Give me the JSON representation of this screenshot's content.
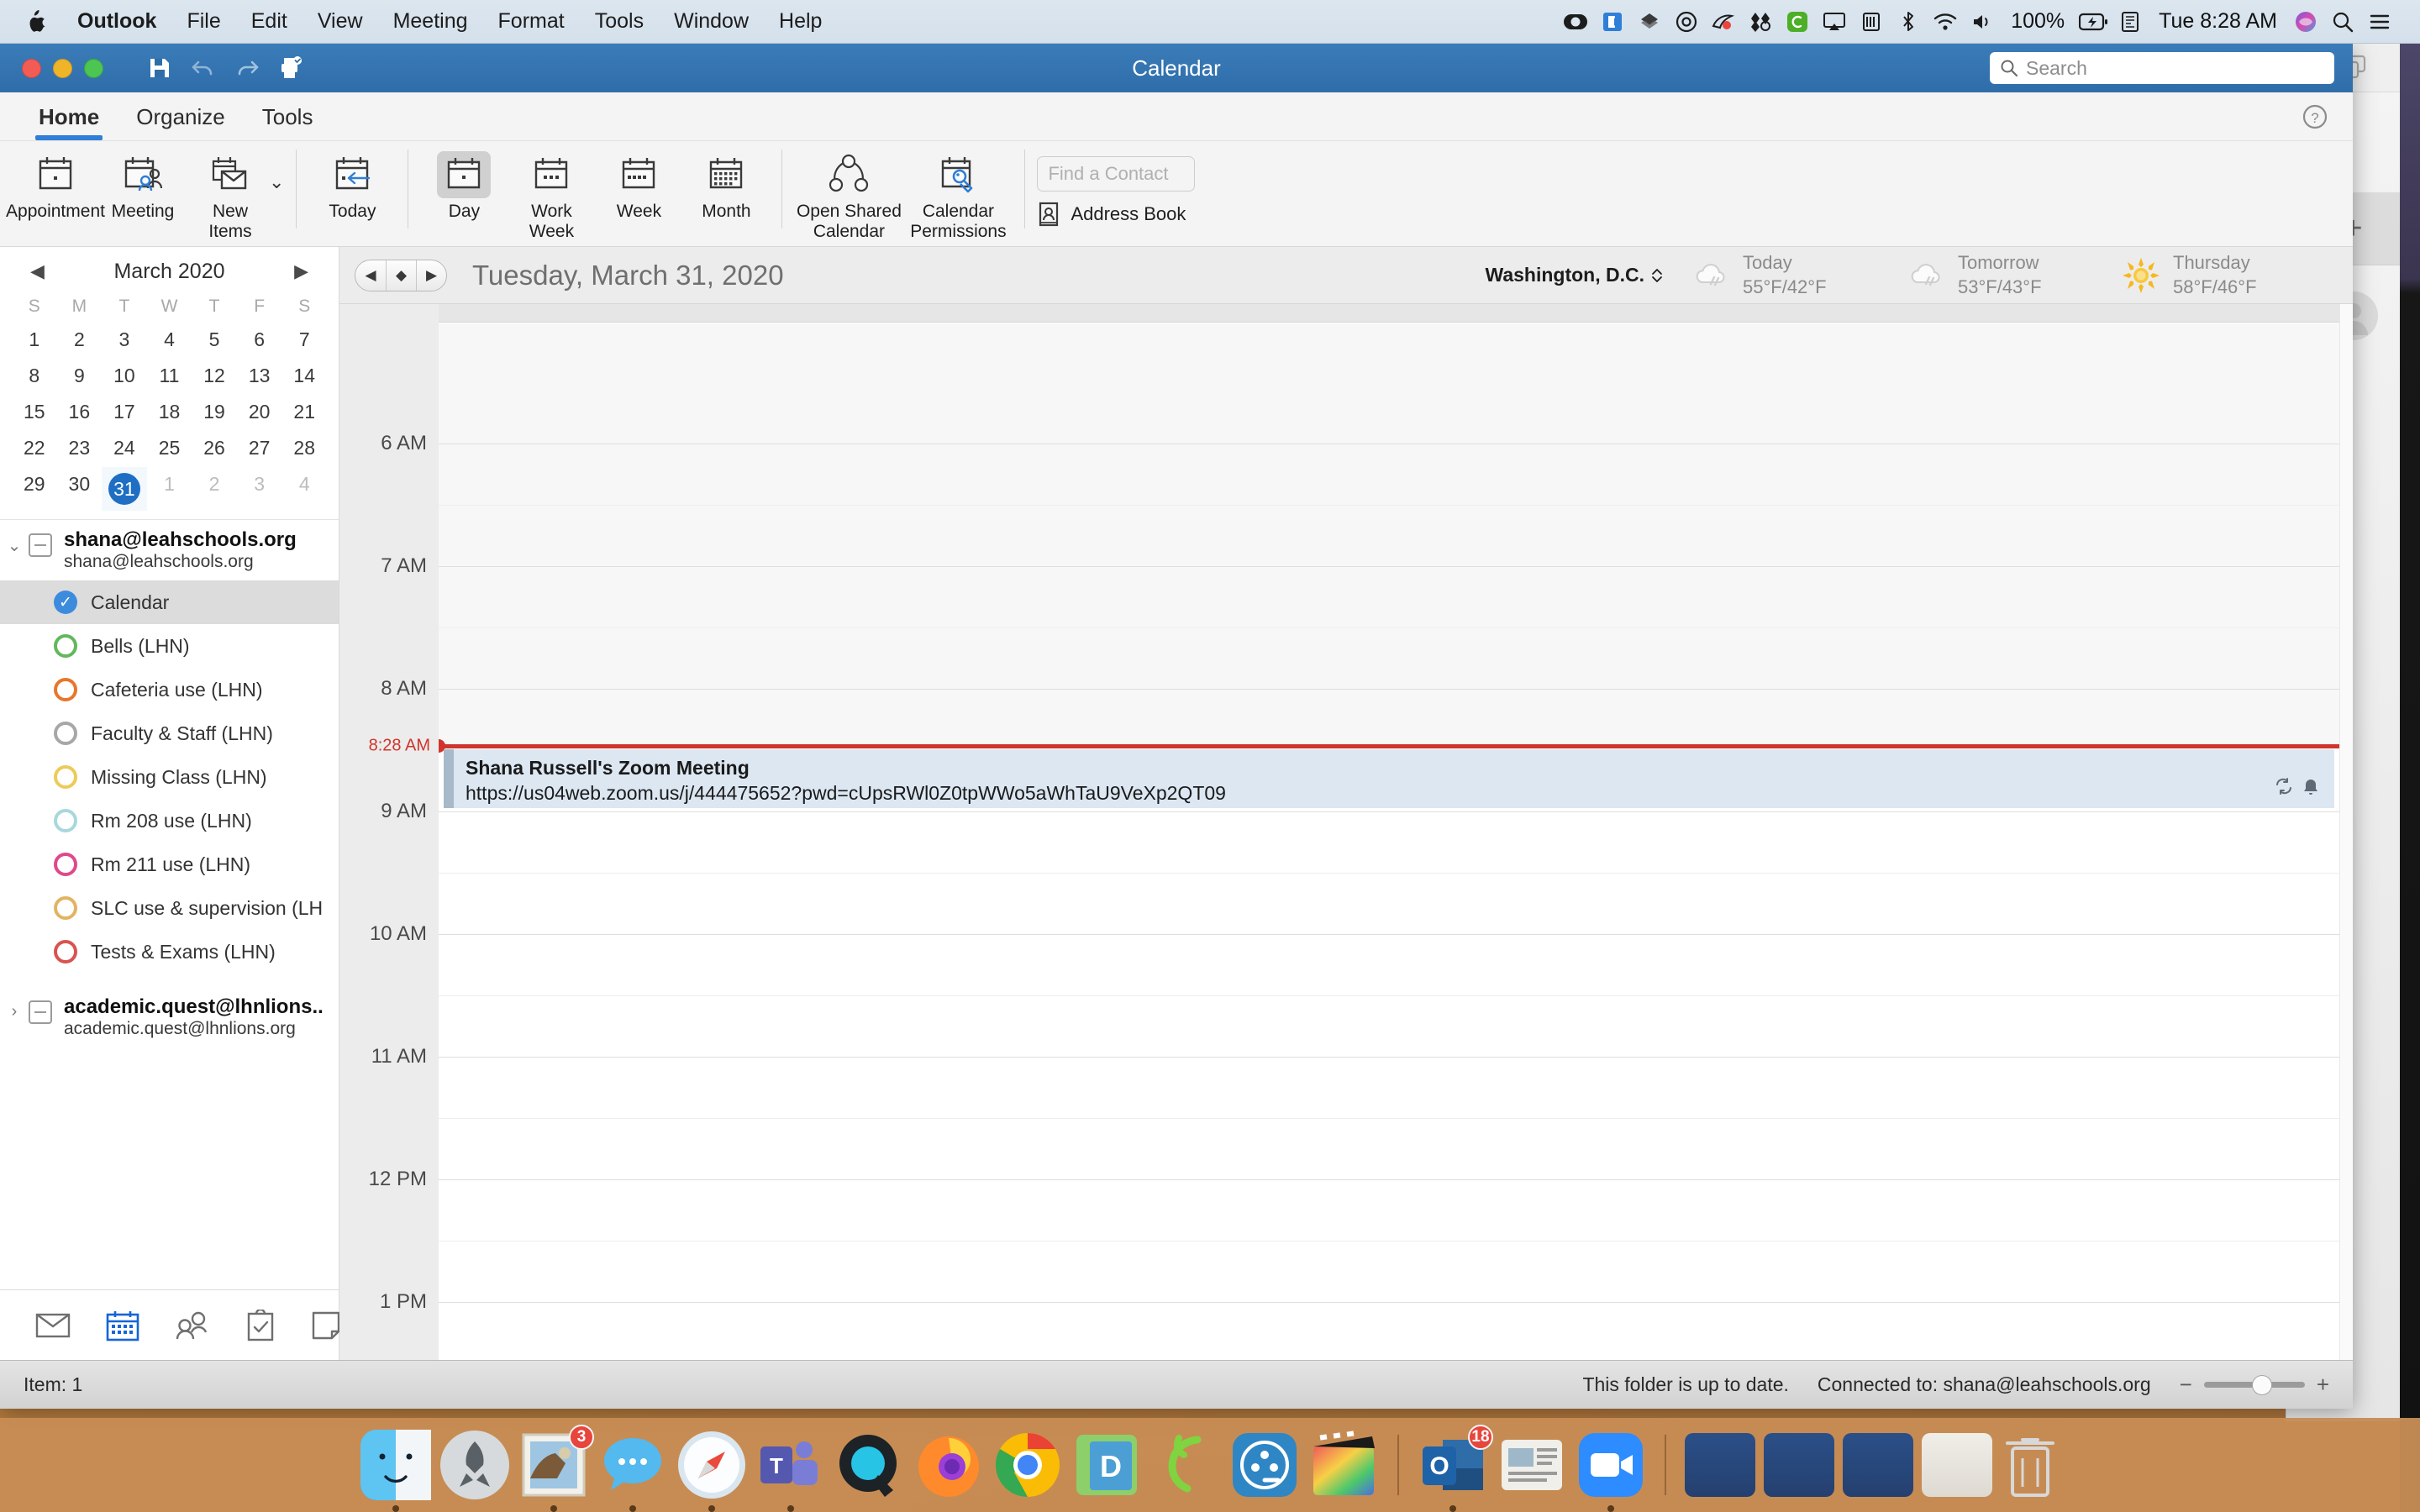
{
  "menubar": {
    "apple": "",
    "items": [
      {
        "label": "Outlook",
        "bold": true
      },
      {
        "label": "File",
        "bold": false
      },
      {
        "label": "Edit",
        "bold": false
      },
      {
        "label": "View",
        "bold": false
      },
      {
        "label": "Meeting",
        "bold": false
      },
      {
        "label": "Format",
        "bold": false
      },
      {
        "label": "Tools",
        "bold": false
      },
      {
        "label": "Window",
        "bold": false
      },
      {
        "label": "Help",
        "bold": false
      }
    ],
    "status_icons": [
      "screen-recording-icon",
      "display-sharing-icon",
      "dropbox-icon",
      "do-not-disturb-icon",
      "logitech-icon",
      "flux-icon",
      "creative-cloud-icon",
      "airplay-icon",
      "keyboard-icon",
      "bluetooth-icon",
      "wifi-icon",
      "volume-icon"
    ],
    "battery_percent": "100%",
    "battery_icon": "battery-charging-icon",
    "siri_icon": "siri-icon",
    "search_icon": "spotlight-search-icon",
    "control_center_icon": "control-center-icon",
    "time_machine_icon": "time-machine-icon",
    "clock": "Tue 8:28 AM"
  },
  "window": {
    "title": "Calendar",
    "quick_actions": [
      "save-icon",
      "undo-icon",
      "redo-icon",
      "print-icon"
    ],
    "search_placeholder": "Search",
    "traffic_lights": [
      "close",
      "minimize",
      "zoom"
    ]
  },
  "ribbon": {
    "tabs": [
      {
        "label": "Home",
        "active": true
      },
      {
        "label": "Organize",
        "active": false
      },
      {
        "label": "Tools",
        "active": false
      }
    ],
    "buttons": [
      {
        "label": "Appointment",
        "icon": "calendar-appointment-icon",
        "selected": false
      },
      {
        "label": "Meeting",
        "icon": "calendar-meeting-icon",
        "selected": false
      },
      {
        "label": "New\nItems",
        "icon": "new-items-icon",
        "selected": false
      },
      {
        "label": "Today",
        "icon": "today-icon",
        "selected": false
      },
      {
        "label": "Day",
        "icon": "day-view-icon",
        "selected": true
      },
      {
        "label": "Work\nWeek",
        "icon": "work-week-view-icon",
        "selected": false
      },
      {
        "label": "Week",
        "icon": "week-view-icon",
        "selected": false
      },
      {
        "label": "Month",
        "icon": "month-view-icon",
        "selected": false
      },
      {
        "label": "Open Shared\nCalendar",
        "icon": "open-shared-calendar-icon",
        "selected": false
      },
      {
        "label": "Calendar\nPermissions",
        "icon": "calendar-permissions-icon",
        "selected": false
      }
    ],
    "find_contact_placeholder": "Find a Contact",
    "address_book_label": "Address Book",
    "help_icon": "help-question-icon"
  },
  "minicalendar": {
    "title": "March 2020",
    "prev": "◀",
    "next": "▶",
    "dow": [
      "S",
      "M",
      "T",
      "W",
      "T",
      "F",
      "S"
    ],
    "weeks": [
      [
        {
          "d": "1"
        },
        {
          "d": "2"
        },
        {
          "d": "3"
        },
        {
          "d": "4"
        },
        {
          "d": "5"
        },
        {
          "d": "6"
        },
        {
          "d": "7"
        }
      ],
      [
        {
          "d": "8"
        },
        {
          "d": "9"
        },
        {
          "d": "10"
        },
        {
          "d": "11"
        },
        {
          "d": "12"
        },
        {
          "d": "13"
        },
        {
          "d": "14"
        }
      ],
      [
        {
          "d": "15"
        },
        {
          "d": "16"
        },
        {
          "d": "17"
        },
        {
          "d": "18"
        },
        {
          "d": "19"
        },
        {
          "d": "20"
        },
        {
          "d": "21"
        }
      ],
      [
        {
          "d": "22"
        },
        {
          "d": "23"
        },
        {
          "d": "24"
        },
        {
          "d": "25"
        },
        {
          "d": "26"
        },
        {
          "d": "27"
        },
        {
          "d": "28"
        }
      ],
      [
        {
          "d": "29"
        },
        {
          "d": "30"
        },
        {
          "d": "31",
          "today": true
        },
        {
          "d": "1",
          "other": true
        },
        {
          "d": "2",
          "other": true
        },
        {
          "d": "3",
          "other": true
        },
        {
          "d": "4",
          "other": true
        }
      ]
    ]
  },
  "sidebar": {
    "accounts": [
      {
        "name": "shana@leahschools.org",
        "email": "shana@leahschools.org",
        "expanded": true,
        "disclosure": "⌄",
        "calendars": [
          {
            "label": "Calendar",
            "color": "#3d8bdd",
            "checked": true,
            "selected": true
          },
          {
            "label": "Bells (LHN)",
            "color": "#63b75d",
            "checked": false,
            "selected": false
          },
          {
            "label": "Cafeteria use (LHN)",
            "color": "#e8762b",
            "checked": false,
            "selected": false
          },
          {
            "label": "Faculty & Staff (LHN)",
            "color": "#a0a0a0",
            "checked": false,
            "selected": false
          },
          {
            "label": "Missing Class (LHN)",
            "color": "#efc košice",
            "checked": false,
            "selected": false
          },
          {
            "label": "Rm 208 use (LHN)",
            "color": "#a8d8dc",
            "checked": false,
            "selected": false
          },
          {
            "label": "Rm 211 use (LHN)",
            "color": "#e0488d",
            "checked": false,
            "selected": false
          },
          {
            "label": "SLC use & supervision (LH",
            "color": "#e2b461",
            "checked": false,
            "selected": false
          },
          {
            "label": "Tests & Exams (LHN)",
            "color": "#d9534f",
            "checked": false,
            "selected": false
          }
        ]
      },
      {
        "name": "academic.quest@lhnlions..",
        "email": "academic.quest@lhnlions.org",
        "expanded": false,
        "disclosure": "›",
        "calendars": []
      }
    ],
    "nav_icons": [
      {
        "name": "mail-icon",
        "active": false
      },
      {
        "name": "calendar-icon",
        "active": true
      },
      {
        "name": "people-icon",
        "active": false
      },
      {
        "name": "tasks-icon",
        "active": false
      },
      {
        "name": "notes-icon",
        "active": false
      }
    ]
  },
  "calendar": {
    "stepper": {
      "prev": "◀",
      "today": "◆",
      "next": "▶"
    },
    "day_title": "Tuesday, March 31, 2020",
    "city": "Washington,  D.C.",
    "city_chevron": "⌃",
    "weather": [
      {
        "day": "Today",
        "temps": "55°F/42°F",
        "icon": "cloudy-icon"
      },
      {
        "day": "Tomorrow",
        "temps": "53°F/43°F",
        "icon": "cloudy-icon"
      },
      {
        "day": "Thursday",
        "temps": "58°F/46°F",
        "icon": "sunny-icon"
      }
    ],
    "hours": [
      "6 AM",
      "7 AM",
      "8 AM",
      "9 AM",
      "10 AM",
      "11 AM",
      "12 PM",
      "1 PM"
    ],
    "now_label": "8:28 AM",
    "event": {
      "title": "Shana Russell's Zoom Meeting",
      "url": "https://us04web.zoom.us/j/444475652?pwd=cUpsRWl0Z0tpWWo5aWhTaU9VeXp2QT09",
      "badges": [
        "recurring-icon",
        "reminder-icon"
      ]
    }
  },
  "statusbar": {
    "item_count": "Item: 1",
    "sync_status": "This folder is up to date.",
    "connection": "Connected to: shana@leahschools.org",
    "zoom_minus": "−",
    "zoom_plus": "+"
  },
  "rightpanel": {
    "windows_icon": "window-stack-icon",
    "plus_label": "+",
    "avatar": "user-avatar-icon"
  },
  "dock": {
    "apps": [
      {
        "name": "finder",
        "badge": null,
        "running": true
      },
      {
        "name": "launchpad",
        "badge": null,
        "running": false
      },
      {
        "name": "mail",
        "badge": "3",
        "running": true
      },
      {
        "name": "messages",
        "badge": null,
        "running": true
      },
      {
        "name": "safari",
        "badge": null,
        "running": true
      },
      {
        "name": "microsoft-teams",
        "badge": null,
        "running": true
      },
      {
        "name": "qbittorrent",
        "badge": null,
        "running": false
      },
      {
        "name": "firefox",
        "badge": null,
        "running": false
      },
      {
        "name": "google-chrome",
        "badge": null,
        "running": false
      },
      {
        "name": "dreamweaver",
        "badge": null,
        "running": false
      },
      {
        "name": "camtasia",
        "badge": null,
        "running": false
      },
      {
        "name": "screenflow",
        "badge": null,
        "running": false
      },
      {
        "name": "final-cut-pro",
        "badge": null,
        "running": false
      },
      {
        "name": "outlook",
        "badge": "18",
        "running": true
      },
      {
        "name": "news",
        "badge": null,
        "running": false
      },
      {
        "name": "zoom",
        "badge": null,
        "running": true
      }
    ],
    "folders": [
      "documents-folder",
      "downloads-folder",
      "applications-folder",
      "stack-folder"
    ],
    "trash": "trash-icon"
  }
}
